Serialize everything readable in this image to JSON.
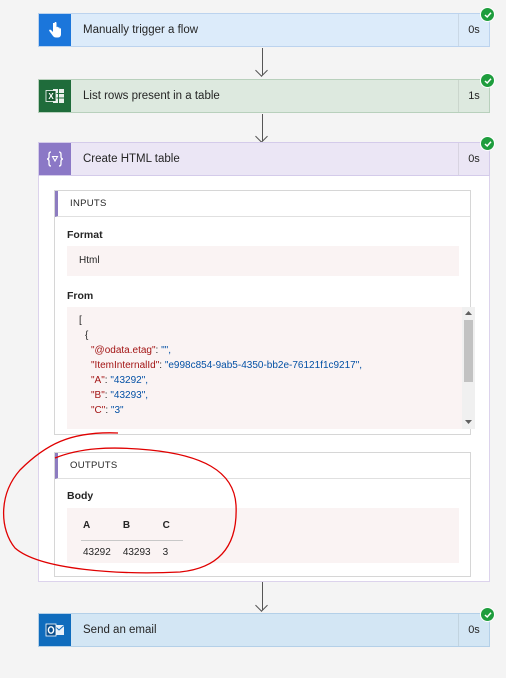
{
  "steps": {
    "trigger": {
      "title": "Manually trigger a flow",
      "duration": "0s",
      "header_bg": "#dcebfa",
      "border": "#bcd3ee",
      "icon_bg": "#1b76db"
    },
    "list_rows": {
      "title": "List rows present in a table",
      "duration": "1s",
      "header_bg": "#dde9df",
      "border": "#b8d0bc",
      "icon_bg": "#1f6c3b"
    },
    "create_html": {
      "title": "Create HTML table",
      "duration": "0s",
      "header_bg": "#ebe6f5",
      "border": "#d4cbea",
      "icon_bg": "#8b78c6"
    },
    "send_email": {
      "title": "Send an email",
      "duration": "0s",
      "header_bg": "#d3e6f4",
      "border": "#b4d0e8",
      "icon_bg": "#0f6cbd"
    }
  },
  "inputs": {
    "header": "INPUTS",
    "format_label": "Format",
    "format_value": "Html",
    "from_label": "From",
    "from_lines": {
      "l1": "[",
      "l2": "{",
      "etag_key": "\"@odata.etag\"",
      "etag_val": "\"\",",
      "id_key": "\"ItemInternalId\"",
      "id_val": "\"e998c854-9ab5-4350-bb2e-76121f1c9217\",",
      "a_key": "\"A\"",
      "a_val": "\"43292\",",
      "b_key": "\"B\"",
      "b_val": "\"43293\",",
      "c_key": "\"C\"",
      "c_val": "\"3\""
    }
  },
  "outputs": {
    "header": "OUTPUTS",
    "body_label": "Body",
    "table": {
      "headers": [
        "A",
        "B",
        "C"
      ],
      "rows": [
        [
          "43292",
          "43293",
          "3"
        ]
      ]
    }
  },
  "icons": {
    "trigger": "touch-hand-icon",
    "excel": "excel-icon",
    "data_operation": "data-operation-icon",
    "outlook": "outlook-icon",
    "success": "check-icon"
  },
  "annotation_color": "#e00000"
}
